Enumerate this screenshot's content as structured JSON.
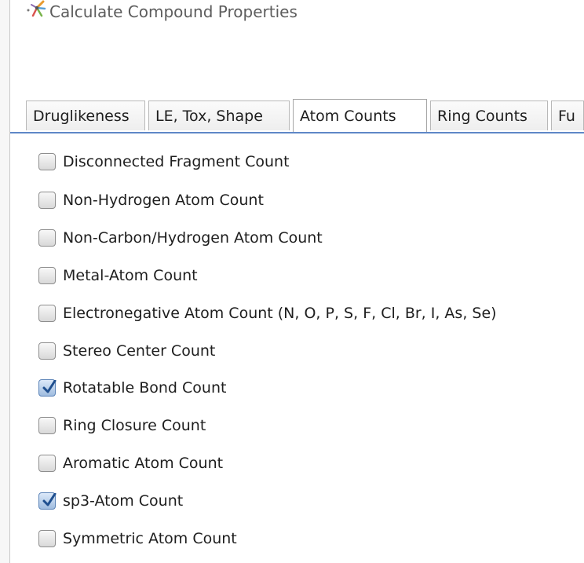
{
  "window": {
    "title": "Calculate Compound Properties",
    "app_icon": "app-logo-icon"
  },
  "tabs": [
    {
      "label": "Druglikeness",
      "active": false
    },
    {
      "label": "LE, Tox, Shape",
      "active": false
    },
    {
      "label": "Atom Counts",
      "active": true
    },
    {
      "label": "Ring Counts",
      "active": false
    },
    {
      "label": "Fu",
      "active": false
    }
  ],
  "options": [
    {
      "label": "Disconnected Fragment Count",
      "checked": false
    },
    {
      "label": "Non-Hydrogen Atom Count",
      "checked": false
    },
    {
      "label": "Non-Carbon/Hydrogen Atom Count",
      "checked": false
    },
    {
      "label": "Metal-Atom Count",
      "checked": false
    },
    {
      "label": "Electronegative Atom Count (N, O, P, S, F, Cl, Br, I, As, Se)",
      "checked": false
    },
    {
      "label": "Stereo Center Count",
      "checked": false
    },
    {
      "label": "Rotatable Bond Count",
      "checked": true
    },
    {
      "label": "Ring Closure Count",
      "checked": false
    },
    {
      "label": "Aromatic Atom Count",
      "checked": false
    },
    {
      "label": "sp3-Atom Count",
      "checked": true
    },
    {
      "label": "Symmetric Atom Count",
      "checked": false
    }
  ],
  "colors": {
    "tab_accent": "#5f87c7",
    "checked_fill": "#9fbcdf",
    "checkmark": "#1f4f8f"
  }
}
